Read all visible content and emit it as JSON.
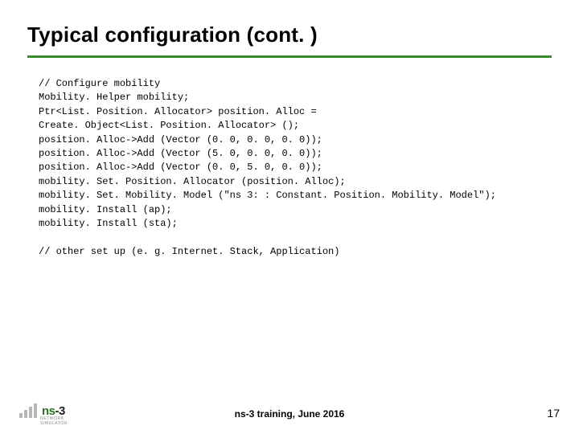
{
  "title": "Typical configuration (cont. )",
  "code_lines": [
    "// Configure mobility",
    "Mobility. Helper mobility;",
    "Ptr<List. Position. Allocator> position. Alloc =",
    "Create. Object<List. Position. Allocator> ();",
    "position. Alloc->Add (Vector (0. 0, 0. 0, 0. 0));",
    "position. Alloc->Add (Vector (5. 0, 0. 0, 0. 0));",
    "position. Alloc->Add (Vector (0. 0, 5. 0, 0. 0));",
    "mobility. Set. Position. Allocator (position. Alloc);",
    "mobility. Set. Mobility. Model (\"ns 3: : Constant. Position. Mobility. Model\");",
    "mobility. Install (ap);",
    "mobility. Install (sta);",
    "",
    "// other set up (e. g. Internet. Stack, Application)"
  ],
  "footer": {
    "center": "ns-3 training, June 2016",
    "page": "17",
    "logo_brand": "ns",
    "logo_suffix": "-3",
    "logo_tag": "NETWORK SIMULATOR"
  }
}
